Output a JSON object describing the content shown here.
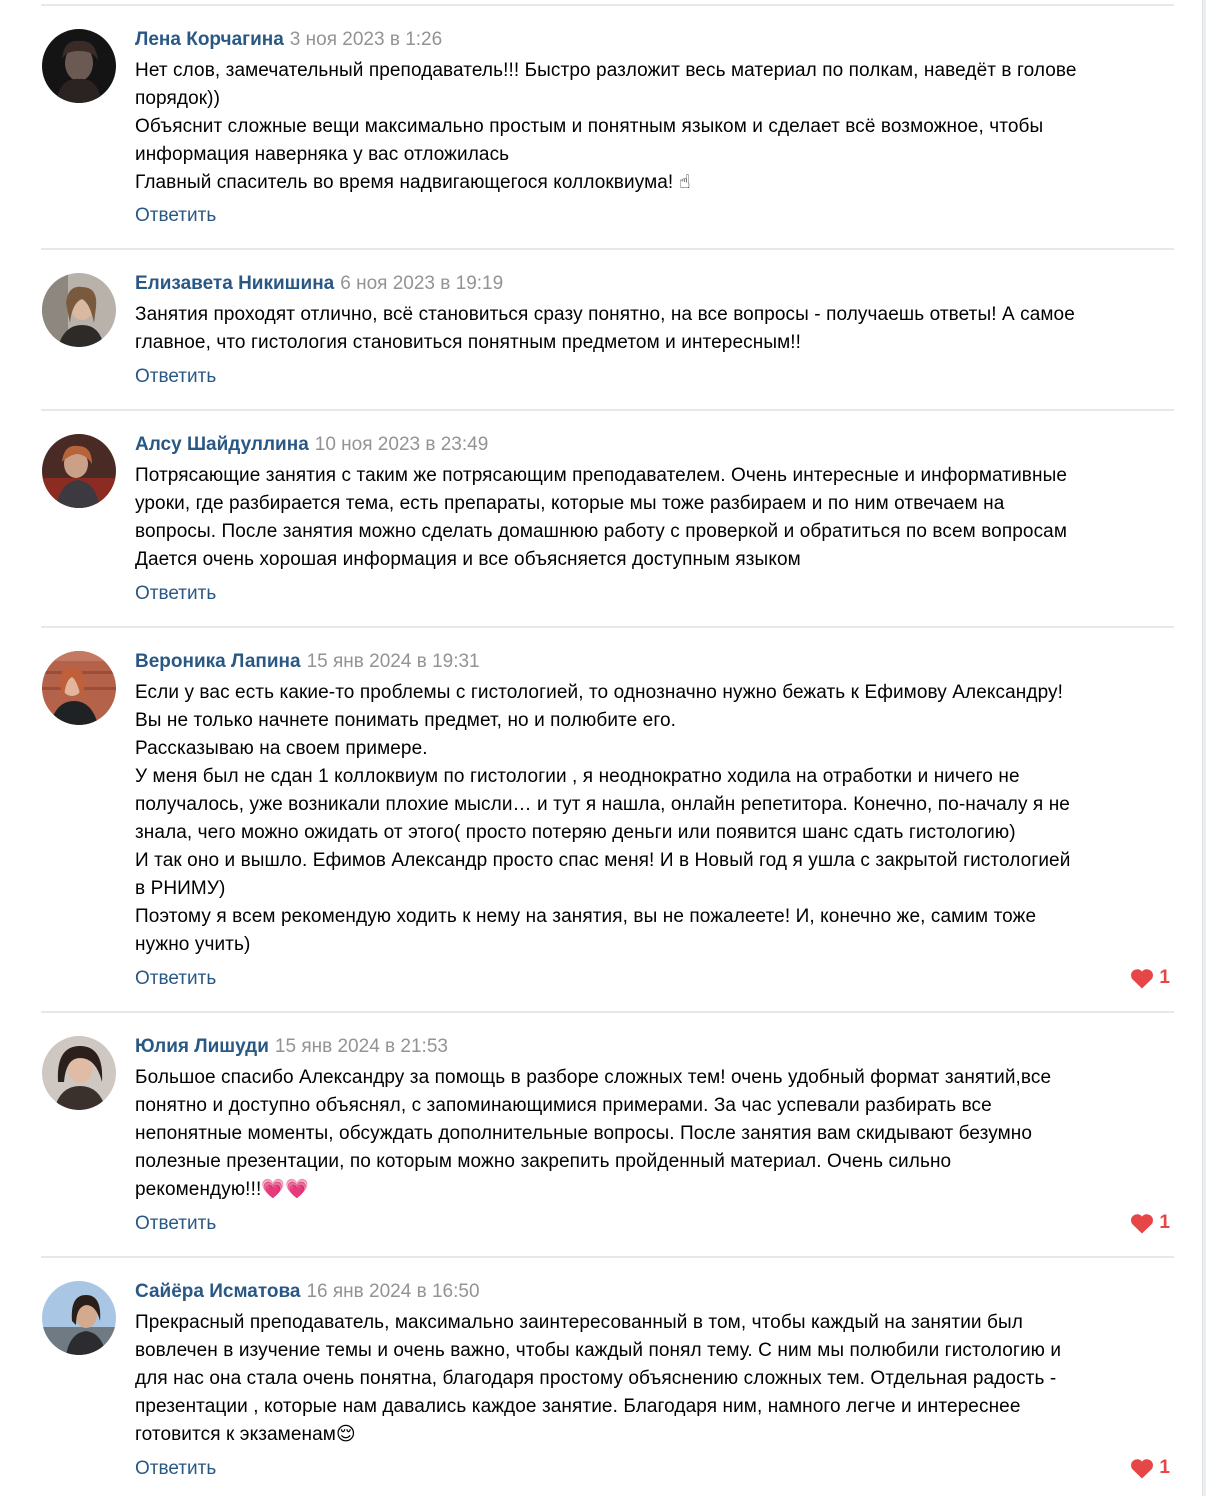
{
  "comments": [
    {
      "author": "Лена Корчагина",
      "date": "3 ноя 2023 в 1:26",
      "text": "Нет слов, замечательный преподаватель!!! Быстро разложит весь материал по полкам, наведёт в голове\nпорядок))\nОбъяснит сложные вещи максимально простым и понятным языком и сделает всё возможное, чтобы\nинформация наверняка у вас отложилась\nГлавный спаситель во время надвигающегося коллоквиума! ☝",
      "reply_label": "Ответить",
      "avatar_icon": "avatar-photo-dark"
    },
    {
      "author": "Елизавета Никишина",
      "date": "6 ноя 2023 в 19:19",
      "text": "Занятия проходят отлично, всё становиться сразу понятно, на все вопросы - получаешь ответы! А самое\nглавное, что гистология становиться понятным предметом и интересным!!",
      "reply_label": "Ответить",
      "avatar_icon": "avatar-photo-mirror"
    },
    {
      "author": "Алсу Шайдуллина",
      "date": "10 ноя 2023 в 23:49",
      "text": "Потрясающие занятия с таким же потрясающим преподавателем. Очень интересные и информативные\nуроки, где разбирается тема, есть препараты, которые мы тоже разбираем и по ним отвечаем на\nвопросы. После занятия можно сделать домашнюю работу с проверкой и обратиться по всем вопросам\nДается очень хорошая информация и все объясняется доступным языком",
      "reply_label": "Ответить",
      "avatar_icon": "avatar-photo-red"
    },
    {
      "author": "Вероника Лапина",
      "date": "15 янв 2024 в 19:31",
      "text": "Если у вас есть какие-то проблемы с гистологией, то однозначно нужно бежать к Ефимову Александру!\nВы не только начнете понимать предмет, но и полюбите его.\nРассказываю на своем примере.\nУ меня был не сдан 1 коллоквиум по гистологии , я неоднократно ходила на отработки и ничего не\nполучалось, уже возникали плохие мысли… и тут я нашла, онлайн репетитора. Конечно, по-началу я не\nзнала, чего можно ожидать от этого( просто потеряю деньги или появится шанс сдать гистологию)\nИ так оно и вышло. Ефимов Александр просто спас меня! И в Новый год я ушла с закрытой гистологией\nв РНИМУ)\nПоэтому я всем рекомендую ходить к нему на занятия, вы не пожалеете! И, конечно же, самим тоже\nнужно учить)",
      "reply_label": "Ответить",
      "likes": "1",
      "avatar_icon": "avatar-photo-brick"
    },
    {
      "author": "Юлия Лишуди",
      "date": "15 янв 2024 в 21:53",
      "text": "Большое спасибо Александру за помощь в разборе сложных тем! очень удобный формат занятий,все\nпонятно и доступно объяснял, с запоминающимися примерами. За час успевали разбирать все\nнепонятные моменты, обсуждать дополнительные вопросы. После занятия вам скидывают безумно\nполезные презентации, по которым можно закрепить пройденный материал. Очень сильно\nрекомендую!!!💗💗",
      "reply_label": "Ответить",
      "likes": "1",
      "avatar_icon": "avatar-photo-portrait"
    },
    {
      "author": "Сайёра Исматова",
      "date": "16 янв 2024 в 16:50",
      "text": "Прекрасный преподаватель, максимально заинтересованный в том, чтобы каждый на занятии был\nвовлечен в изучение темы и очень важно, чтобы каждый понял тему. С ним мы полюбили гистологию и\nдля нас она стала очень понятна, благодаря простому объяснению сложных тем. Отдельная радость -\nпрезентации , которые нам давались каждое занятие. Благодаря ним, намного легче и интереснее\nготовится к экзаменам😌",
      "reply_label": "Ответить",
      "likes": "1",
      "avatar_icon": "avatar-photo-sky"
    }
  ]
}
